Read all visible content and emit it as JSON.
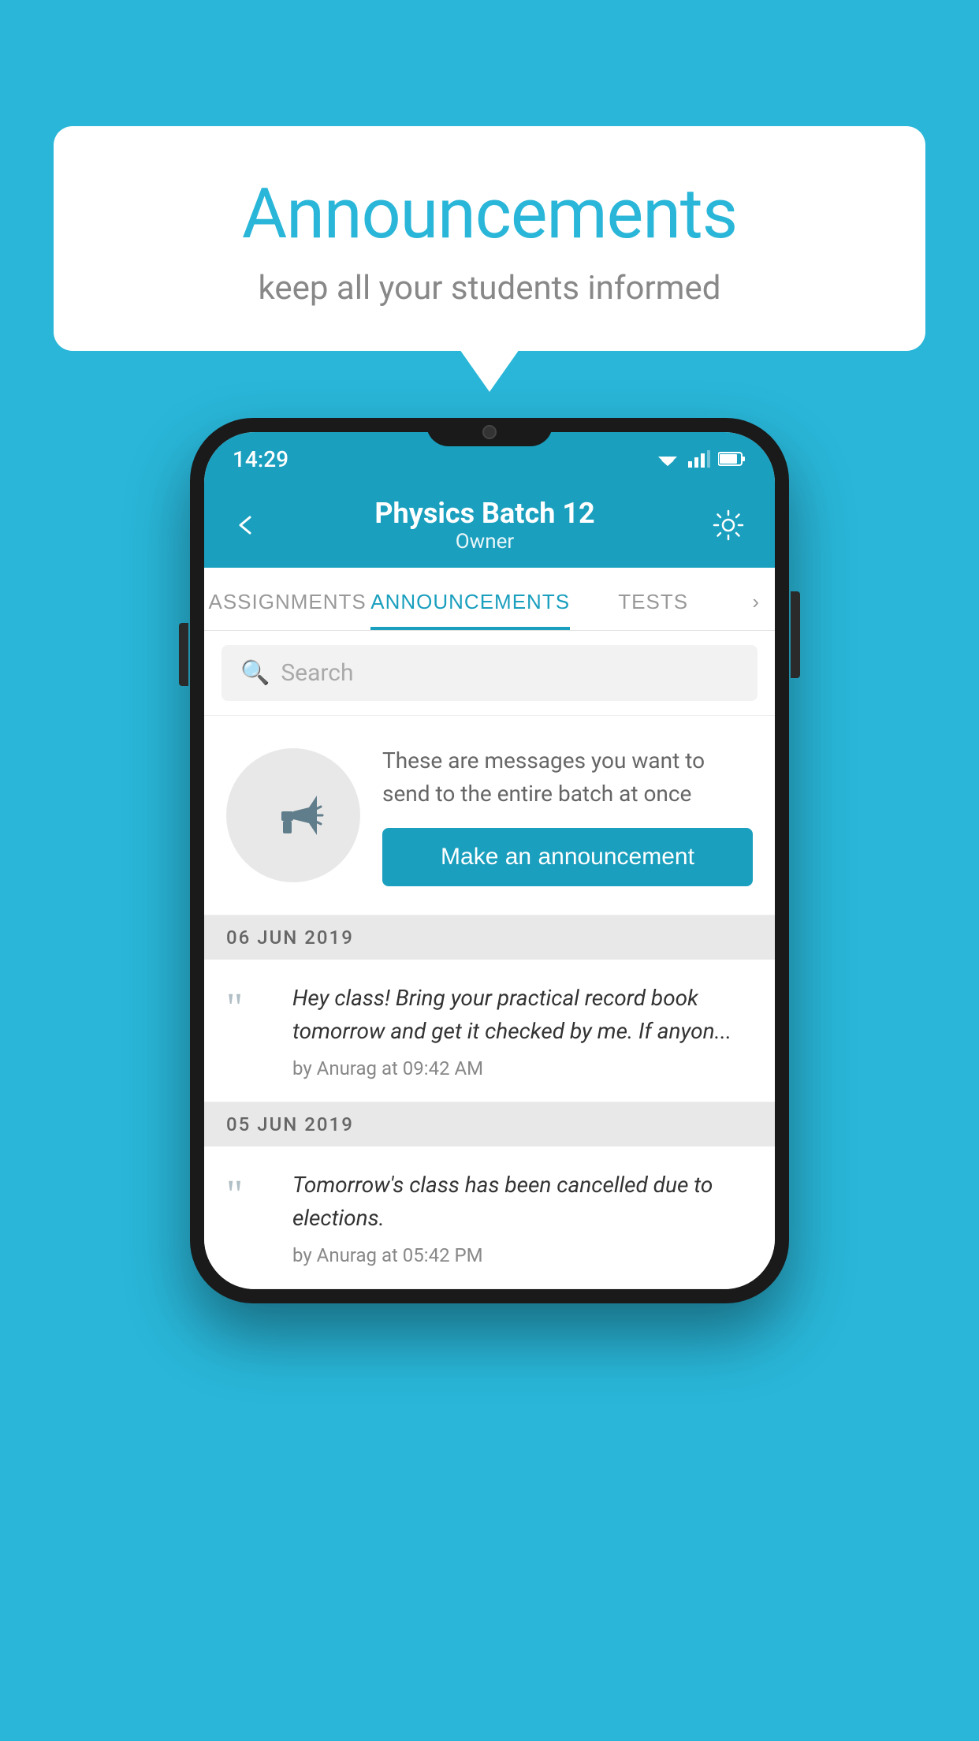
{
  "background_color": "#29b6d8",
  "speech_bubble": {
    "title": "Announcements",
    "subtitle": "keep all your students informed"
  },
  "status_bar": {
    "time": "14:29"
  },
  "app_bar": {
    "title": "Physics Batch 12",
    "subtitle": "Owner",
    "back_label": "back",
    "settings_label": "settings"
  },
  "tabs": [
    {
      "label": "ASSIGNMENTS",
      "active": false
    },
    {
      "label": "ANNOUNCEMENTS",
      "active": true
    },
    {
      "label": "TESTS",
      "active": false
    }
  ],
  "search": {
    "placeholder": "Search"
  },
  "promo": {
    "description": "These are messages you want to send to the entire batch at once",
    "button_label": "Make an announcement"
  },
  "announcements": [
    {
      "date": "06  JUN  2019",
      "text": "Hey class! Bring your practical record book tomorrow and get it checked by me. If anyon...",
      "meta": "by Anurag at 09:42 AM"
    },
    {
      "date": "05  JUN  2019",
      "text": "Tomorrow's class has been cancelled due to elections.",
      "meta": "by Anurag at 05:42 PM"
    }
  ]
}
